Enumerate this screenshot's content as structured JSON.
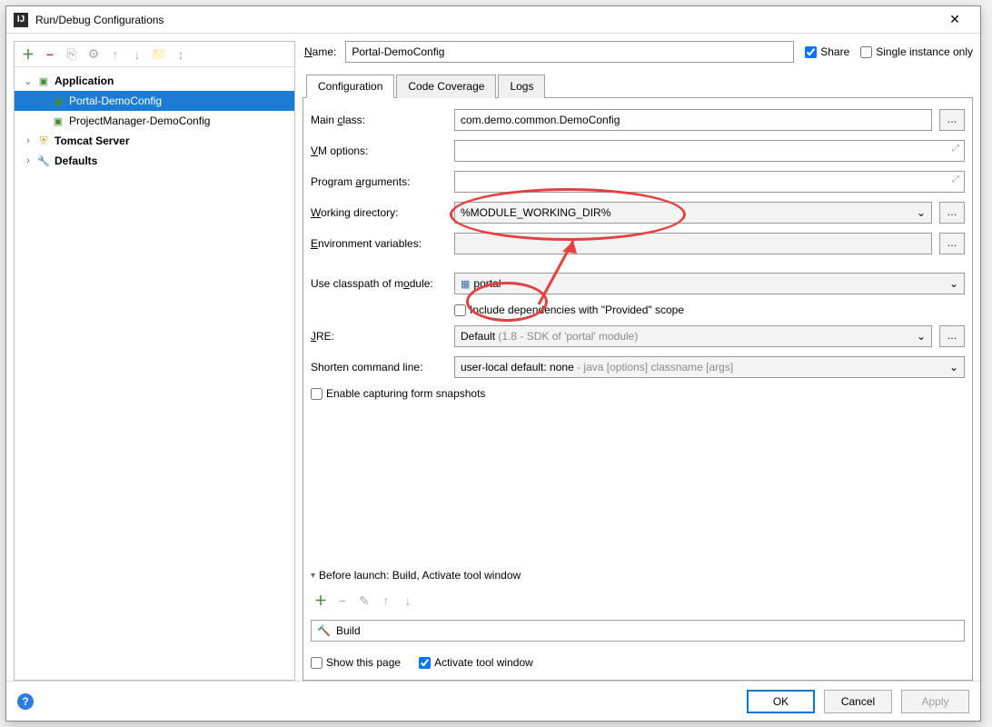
{
  "window": {
    "title": "Run/Debug Configurations"
  },
  "tree": {
    "application": {
      "label": "Application",
      "expanded": true
    },
    "items": [
      {
        "label": "Portal-DemoConfig"
      },
      {
        "label": "ProjectManager-DemoConfig"
      }
    ],
    "tomcat": {
      "label": "Tomcat Server"
    },
    "defaults": {
      "label": "Defaults"
    }
  },
  "name": {
    "label": "Name:",
    "value": "Portal-DemoConfig"
  },
  "share": {
    "label": "Share",
    "checked": true
  },
  "singleInstance": {
    "label": "Single instance only",
    "checked": false
  },
  "tabs": {
    "configuration": "Configuration",
    "coverage": "Code Coverage",
    "logs": "Logs"
  },
  "fields": {
    "mainClass": {
      "label": "Main class:",
      "value": "com.demo.common.DemoConfig"
    },
    "vmOptions": {
      "label": "VM options:",
      "value": ""
    },
    "programArgs": {
      "label": "Program arguments:",
      "value": ""
    },
    "workingDir": {
      "label": "Working directory:",
      "value": "%MODULE_WORKING_DIR%"
    },
    "envVars": {
      "label": "Environment variables:",
      "value": ""
    },
    "classpathModule": {
      "label": "Use classpath of module:",
      "value": "portal"
    },
    "includeProvided": {
      "label": "Include dependencies with \"Provided\" scope",
      "checked": false
    },
    "jre": {
      "label": "JRE:",
      "value": "Default",
      "hint": "(1.8 - SDK of 'portal' module)"
    },
    "shorten": {
      "label": "Shorten command line:",
      "value": "user-local default: none",
      "hint": " - java [options] classname [args]"
    },
    "enableCapture": {
      "label": "Enable capturing form snapshots",
      "checked": false
    }
  },
  "beforeLaunch": {
    "label": "Before launch: Build, Activate tool window",
    "build": "Build"
  },
  "bottom": {
    "showPage": "Show this page",
    "activateWindow": "Activate tool window"
  },
  "buttons": {
    "ok": "OK",
    "cancel": "Cancel",
    "apply": "Apply"
  }
}
